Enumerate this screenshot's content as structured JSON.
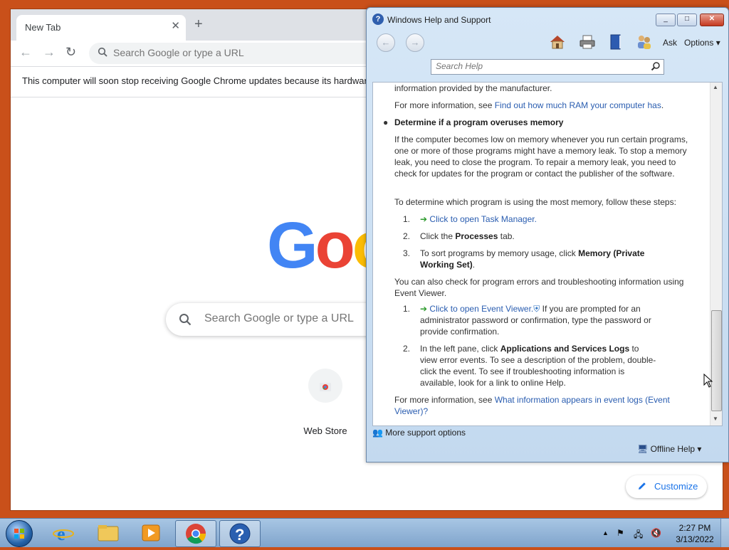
{
  "chrome": {
    "tab_title": "New Tab",
    "new_tab_symbol": "+",
    "omnibox_placeholder": "Search Google or type a URL",
    "infobar_text": "This computer will soon stop receiving Google Chrome updates because its hardware",
    "logo_letters": [
      "G",
      "o",
      "o"
    ],
    "logo_colors": [
      "#4285f4",
      "#ea4335",
      "#fbbc05"
    ],
    "search_placeholder": "Search Google or type a URL",
    "shortcut_label": "Web Store",
    "customize_label": "Customize"
  },
  "help": {
    "title": "Windows Help and Support",
    "ask_label": "Ask",
    "options_label": "Options",
    "search_placeholder": "Search Help",
    "p1": "information provided by the manufacturer.",
    "p2_prefix": "For more information, see ",
    "p2_link": "Find out how much RAM your computer has",
    "p2_suffix": ".",
    "bullet_heading": "Determine if a program overuses memory",
    "p3": "If the computer becomes low on memory whenever you run certain programs, one or more of those programs might have a memory leak. To stop a memory leak, you need to close the program. To repair a memory leak, you need to check for updates for the program or contact the publisher of the software.",
    "p4": "To determine which program is using the most memory, follow these steps:",
    "steps_a": [
      {
        "num": "1.",
        "link": "Click to open Task Manager."
      },
      {
        "num": "2.",
        "pre": "Click the ",
        "bold": "Processes",
        "post": " tab."
      },
      {
        "num": "3.",
        "pre": "To sort programs by memory usage, click ",
        "bold": "Memory (Private Working Set)",
        "post": "."
      }
    ],
    "p5": "You can also check for program errors and troubleshooting information using Event Viewer.",
    "steps_b": [
      {
        "num": "1.",
        "link": "Click to open Event Viewer.",
        "post": " If you are prompted for an administrator password or confirmation, type the password or provide confirmation."
      },
      {
        "num": "2.",
        "pre": "In the left pane, click ",
        "bold": "Applications and Services Logs",
        "post": " to view error events. To see a description of the problem, double-click the event. To see if troubleshooting information is available, look for a link to online Help."
      }
    ],
    "p6_prefix": "For more information, see ",
    "p6_link": "What information appears in event logs (Event Viewer)?",
    "more_support": "More support options",
    "offline_help": "Offline Help"
  },
  "taskbar": {
    "time": "2:27 PM",
    "date": "3/13/2022",
    "accent": "#7fa4cc"
  },
  "icons": [
    "home-icon",
    "print-icon",
    "browse-help-icon",
    "ask-icon",
    "search-icon",
    "chrome-icon",
    "ie-icon",
    "explorer-icon",
    "media-player-icon",
    "help-icon",
    "flag-icon",
    "network-icon",
    "volume-muted-icon"
  ]
}
